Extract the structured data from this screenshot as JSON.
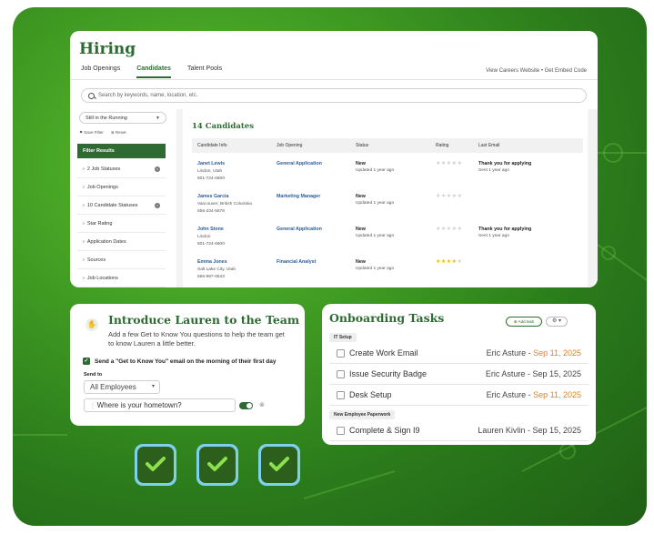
{
  "hiring": {
    "title": "Hiring",
    "tabs": [
      "Job Openings",
      "Candidates",
      "Talent Pools"
    ],
    "links": "View Careers Website  •  Get Embed Code",
    "search_placeholder": "Search by keywords, name, location, etc.",
    "status_filter": "Still in the Running",
    "save_filter": "Save Filter",
    "reset": "Reset",
    "filter_results": "Filter Results",
    "filters": [
      {
        "label": "2 Job Statuses",
        "removable": true
      },
      {
        "label": "Job Openings",
        "removable": false
      },
      {
        "label": "10 Candidate Statuses",
        "removable": true
      },
      {
        "label": "Star Rating",
        "removable": false
      },
      {
        "label": "Application Dates",
        "removable": false
      },
      {
        "label": "Sources",
        "removable": false
      },
      {
        "label": "Job Locations",
        "removable": false
      }
    ],
    "candidate_count": "14 Candidates",
    "columns": [
      "Candidate Info",
      "Job Opening",
      "Status",
      "Rating",
      "Last Email"
    ],
    "candidates": [
      {
        "name": "Janet Lewis",
        "location": "Lindon, Utah",
        "phone": "801-724-6600",
        "job": "General Application",
        "status": "New",
        "updated": "Updated 1 year ago",
        "rating": 0,
        "email": "Thank you for applying",
        "email_sent": "Sent 1 year ago"
      },
      {
        "name": "James Garcia",
        "location": "Vancouver, British Columbia",
        "phone": "555-234-5678",
        "job": "Marketing Manager",
        "status": "New",
        "updated": "Updated 1 year ago",
        "rating": 0,
        "email": "",
        "email_sent": ""
      },
      {
        "name": "John Stone",
        "location": "Lindon",
        "phone": "801-724-6600",
        "job": "General Application",
        "status": "New",
        "updated": "Updated 1 year ago",
        "rating": 0,
        "email": "Thank you for applying",
        "email_sent": "Sent 1 year ago"
      },
      {
        "name": "Emma Jones",
        "location": "Salt Lake City, Utah",
        "phone": "555-987-6543",
        "job": "Financial Analyst",
        "status": "New",
        "updated": "Updated 1 year ago",
        "rating": 4,
        "email": "",
        "email_sent": ""
      }
    ]
  },
  "intro": {
    "title": "Introduce Lauren to the Team",
    "description": "Add a few Get to Know You questions to help the team get to know Lauren a little better.",
    "send_checkbox": "Send a \"Get to Know You\" email on the morning of their first day",
    "send_to_label": "Send to",
    "send_to_value": "All Employees",
    "question": "Where is your hometown?"
  },
  "onboarding": {
    "title": "Onboarding Tasks",
    "add_task": "Add task",
    "groups": [
      {
        "label": "IT Setup",
        "tasks": [
          {
            "name": "Create Work Email",
            "assignee": "Eric Asture",
            "date": "Sep 11, 2025",
            "overdue": true
          },
          {
            "name": "Issue Security Badge",
            "assignee": "Eric Asture",
            "date": "Sep 15, 2025",
            "overdue": false
          },
          {
            "name": "Desk Setup",
            "assignee": "Eric Asture",
            "date": "Sep 11, 2025",
            "overdue": true
          }
        ]
      },
      {
        "label": "New Employee Paperwork",
        "tasks": [
          {
            "name": "Complete & Sign I9",
            "assignee": "Lauren Kivlin",
            "date": "Sep 15, 2025",
            "overdue": false
          }
        ]
      }
    ]
  },
  "colors": {
    "brand_green": "#2d6b33",
    "link_blue": "#2a5d9e",
    "overdue_orange": "#d9822b",
    "star_gold": "#f2b800",
    "tile_border": "#7fd0ea"
  }
}
